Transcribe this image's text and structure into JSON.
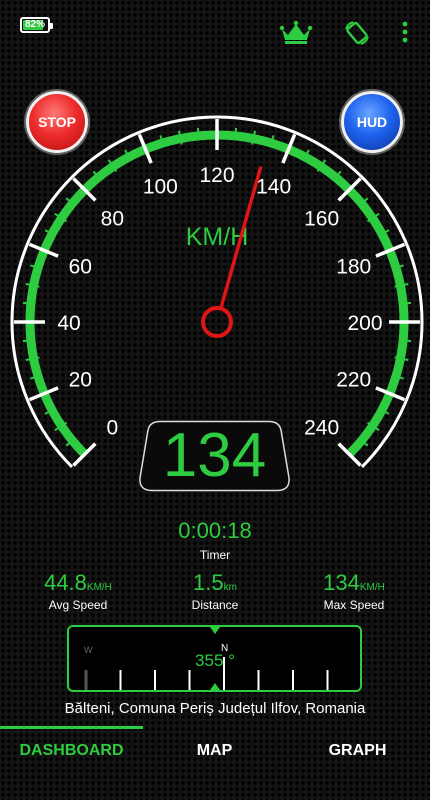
{
  "status_bar": {
    "battery_percent": 82,
    "battery_text": "82%"
  },
  "icons": {
    "premium": "crown-icon",
    "rotate": "screen-rotate-icon",
    "menu": "more-vertical-icon"
  },
  "buttons": {
    "stop_label": "STOP",
    "hud_label": "HUD"
  },
  "gauge": {
    "unit_label": "KM/H",
    "min": 0,
    "max": 240,
    "major_step": 20,
    "tick_labels": [
      "0",
      "20",
      "40",
      "60",
      "80",
      "100",
      "120",
      "140",
      "160",
      "180",
      "200",
      "220",
      "240"
    ],
    "current_speed": 134,
    "needle_color": "#e01515",
    "accent_color": "#2ecc40"
  },
  "digital_speed": "134",
  "trip": {
    "timer": "0:00:18",
    "timer_label": "Timer",
    "avg_speed": {
      "value": "44.8",
      "unit": "KM/H",
      "label": "Avg Speed"
    },
    "distance": {
      "value": "1.5",
      "unit": "km",
      "label": "Distance"
    },
    "max_speed": {
      "value": "134",
      "unit": "KM/H",
      "label": "Max Speed"
    }
  },
  "compass": {
    "heading_text": "355 °",
    "heading": 355,
    "west_label": "W",
    "north_label": "N"
  },
  "location": {
    "address": "Bălteni, Comuna Periș Județul Ilfov, Romania"
  },
  "tabs": [
    {
      "label": "DASHBOARD",
      "active": true
    },
    {
      "label": "MAP",
      "active": false
    },
    {
      "label": "GRAPH",
      "active": false
    }
  ]
}
